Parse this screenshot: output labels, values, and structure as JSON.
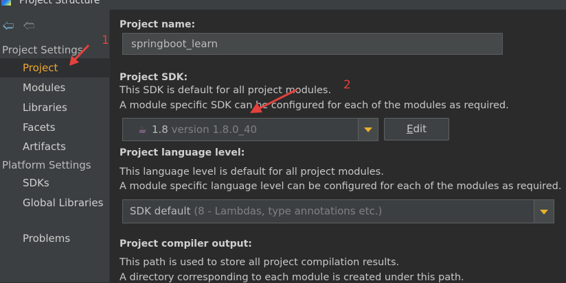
{
  "window": {
    "title": "Project Structure"
  },
  "sidebar": {
    "section_project_settings": "Project Settings",
    "items_project": [
      {
        "label": "Project",
        "selected": true
      },
      {
        "label": "Modules"
      },
      {
        "label": "Libraries"
      },
      {
        "label": "Facets"
      },
      {
        "label": "Artifacts"
      }
    ],
    "section_platform_settings": "Platform Settings",
    "items_platform": [
      {
        "label": "SDKs"
      },
      {
        "label": "Global Libraries"
      }
    ],
    "problems": "Problems"
  },
  "main": {
    "project_name": {
      "label": "Project name:",
      "value": "springboot_learn"
    },
    "project_sdk": {
      "label": "Project SDK:",
      "desc1": "This SDK is default for all project modules.",
      "desc2": "A module specific SDK can be configured for each of the modules as required.",
      "selected_main": "1.8",
      "selected_hint": "version 1.8.0_40",
      "edit_prefix": "E",
      "edit_rest": "dit"
    },
    "language_level": {
      "label": "Project language level:",
      "desc1": "This language level is default for all project modules.",
      "desc2": "A module specific language level can be configured for each of the modules as required.",
      "selected_main": "SDK default",
      "selected_hint": "(8 - Lambdas, type annotations etc.)"
    },
    "compiler_output": {
      "label": "Project compiler output:",
      "desc1": "This path is used to store all project compilation results.",
      "desc2": "A directory corresponding to each module is created under this path."
    }
  },
  "annotations": {
    "marker1": "1",
    "marker2": "2",
    "color": "#e5413d"
  },
  "colors": {
    "selected_text": "#f0a732",
    "dropdown_arrow": "#e9b12c",
    "background": "#2b2b2b",
    "sidebar": "#3c3f41"
  }
}
